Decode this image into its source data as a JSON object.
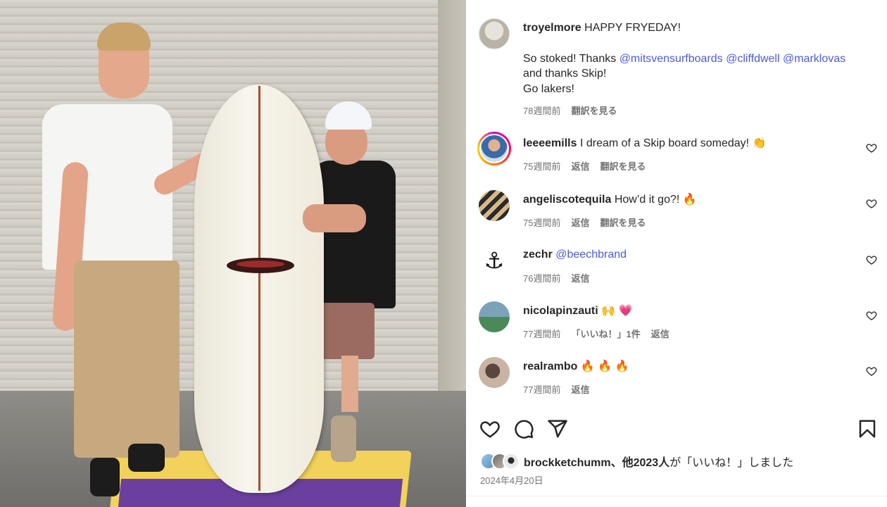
{
  "post": {
    "author": "troyelmore",
    "caption_line1": "HAPPY FRYEDAY!",
    "caption_line2_prefix": "So stoked! Thanks",
    "mentions": [
      "@mitsvensurfboards",
      "@cliffdwell",
      "@marklovas"
    ],
    "caption_line3": "and thanks Skip!",
    "caption_line4": "Go lakers!",
    "time": "78週間前",
    "translate": "翻訳を見る"
  },
  "comments": [
    {
      "user": "leeeemills",
      "text": "I dream of a Skip board someday! 👏",
      "time": "75週間前",
      "reply": "返信",
      "translate": "翻訳を見る"
    },
    {
      "user": "angeliscotequila",
      "text": "How’d it go?! 🔥",
      "time": "75週間前",
      "reply": "返信",
      "translate": "翻訳を見る"
    },
    {
      "user": "zechr",
      "mention": "@beechbrand",
      "time": "76週間前",
      "reply": "返信"
    },
    {
      "user": "nicolapinzauti",
      "text": "🙌 💗",
      "time": "77週間前",
      "likes": "「いいね！」1件",
      "reply": "返信"
    },
    {
      "user": "realrambo",
      "text": "🔥 🔥 🔥",
      "time": "77週間前",
      "reply": "返信"
    }
  ],
  "actions": {
    "like_icon": "heart-icon",
    "comment_icon": "comment-icon",
    "share_icon": "send-icon",
    "save_icon": "bookmark-icon"
  },
  "likes": {
    "user": "brockketchumm",
    "others": "、他2023人",
    "suffix": "が「いいね！」しました"
  },
  "date": "2024年4月20日"
}
